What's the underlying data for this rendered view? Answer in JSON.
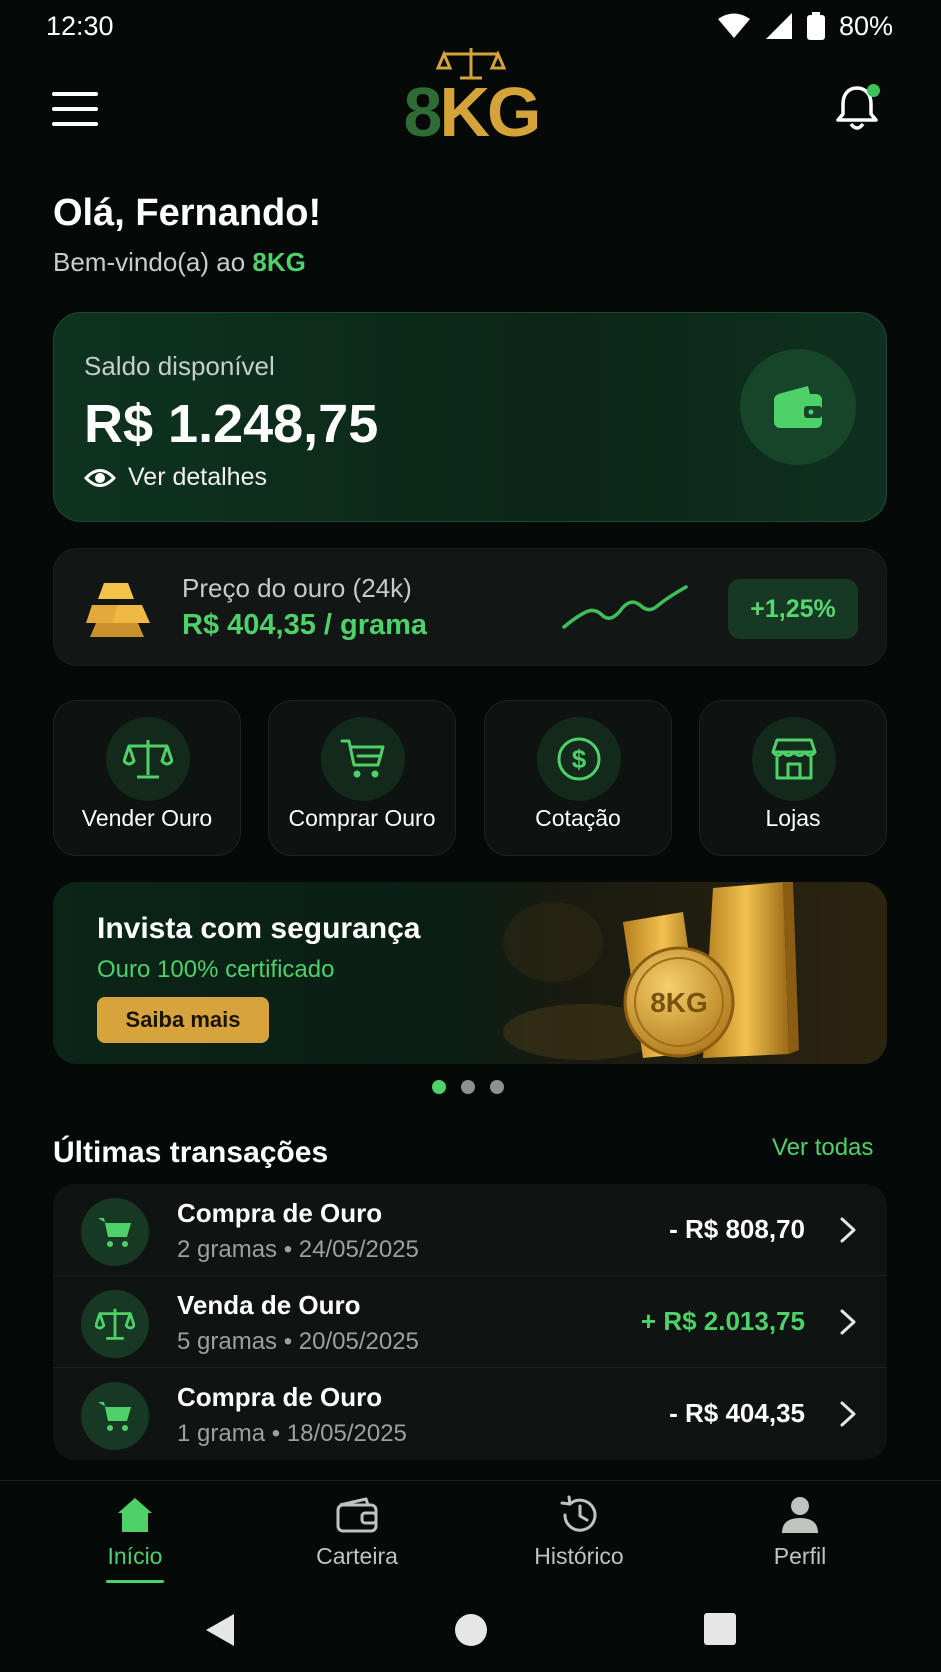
{
  "status_bar": {
    "time": "12:30",
    "battery": "80%"
  },
  "header": {
    "logo_digit": "8",
    "logo_letters": "KG"
  },
  "greeting": {
    "title": "Olá, Fernando!",
    "subtitle_prefix": "Bem-vindo(a) ao ",
    "subtitle_brand": "8KG"
  },
  "balance": {
    "label": "Saldo disponível",
    "value": "R$ 1.248,75",
    "details_label": "Ver detalhes"
  },
  "gold_price": {
    "label": "Preço do ouro (24k)",
    "value": "R$ 404,35 / grama",
    "change": "+1,25%"
  },
  "actions": [
    {
      "label": "Vender Ouro",
      "icon": "scale-icon"
    },
    {
      "label": "Comprar Ouro",
      "icon": "cart-icon"
    },
    {
      "label": "Cotação",
      "icon": "dollar-icon"
    },
    {
      "label": "Lojas",
      "icon": "store-icon"
    }
  ],
  "banner": {
    "title": "Invista com segurança",
    "subtitle": "Ouro 100% certificado",
    "button": "Saiba mais",
    "coin_text": "8KG"
  },
  "carousel": {
    "count": 3,
    "active_index": 0
  },
  "transactions": {
    "title": "Últimas transações",
    "view_all": "Ver todas",
    "items": [
      {
        "title": "Compra de Ouro",
        "subtitle": "2 gramas • 24/05/2025",
        "amount": "- R$ 808,70",
        "type": "buy"
      },
      {
        "title": "Venda de Ouro",
        "subtitle": "5 gramas • 20/05/2025",
        "amount": "+ R$ 2.013,75",
        "type": "sell"
      },
      {
        "title": "Compra de Ouro",
        "subtitle": "1 grama • 18/05/2025",
        "amount": "- R$ 404,35",
        "type": "buy"
      }
    ]
  },
  "bottom_nav": {
    "items": [
      {
        "label": "Início",
        "icon": "home-icon",
        "active": true
      },
      {
        "label": "Carteira",
        "icon": "wallet-icon",
        "active": false
      },
      {
        "label": "Histórico",
        "icon": "history-icon",
        "active": false
      },
      {
        "label": "Perfil",
        "icon": "person-icon",
        "active": false
      }
    ]
  },
  "colors": {
    "accent_green": "#4fd16a",
    "gold": "#d4a33a",
    "dark_green": "#2f6b34",
    "background": "#050a08"
  }
}
